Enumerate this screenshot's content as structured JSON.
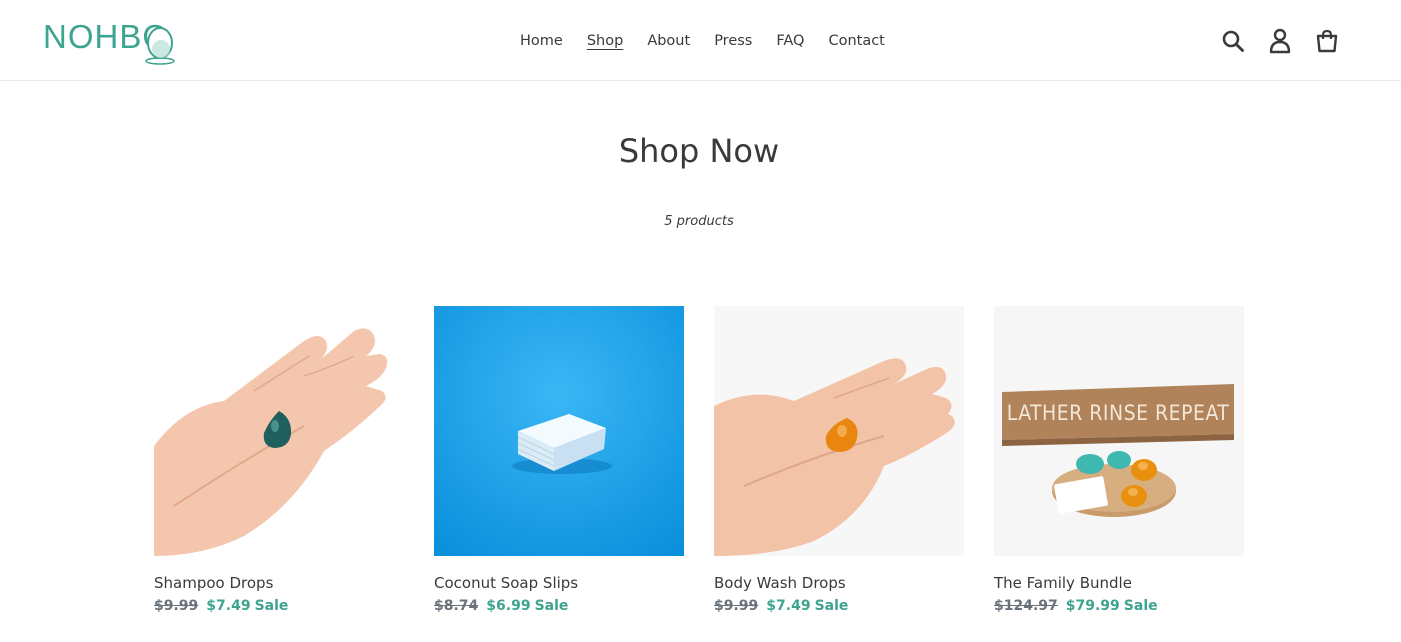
{
  "brand": {
    "logo_text": "NOHBO",
    "color": "#3ea38f"
  },
  "nav": {
    "items": [
      {
        "label": "Home",
        "active": false
      },
      {
        "label": "Shop",
        "active": true
      },
      {
        "label": "About",
        "active": false
      },
      {
        "label": "Press",
        "active": false
      },
      {
        "label": "FAQ",
        "active": false
      },
      {
        "label": "Contact",
        "active": false
      }
    ]
  },
  "header_icons": [
    "search-icon",
    "account-icon",
    "cart-icon"
  ],
  "page": {
    "title": "Shop Now",
    "product_count": "5 products"
  },
  "products": [
    {
      "title": "Shampoo Drops",
      "price_old": "$9.99",
      "price_new": "$7.49",
      "badge": "Sale",
      "image": "hand-with-teal-drop"
    },
    {
      "title": "Coconut Soap Slips",
      "price_old": "$8.74",
      "price_new": "$6.99",
      "badge": "Sale",
      "image": "soap-slips-on-blue"
    },
    {
      "title": "Body Wash Drops",
      "price_old": "$9.99",
      "price_new": "$7.49",
      "badge": "Sale",
      "image": "hand-with-amber-drop"
    },
    {
      "title": "The Family Bundle",
      "price_old": "$124.97",
      "price_new": "$79.99",
      "badge": "Sale",
      "image": "bundle-with-sign",
      "image_text": "LATHER RINSE REPEAT"
    }
  ],
  "colors": {
    "text": "#3a3a3a",
    "sale": "#3ea38f",
    "old_price": "#69727b",
    "border": "#e8e9eb"
  }
}
